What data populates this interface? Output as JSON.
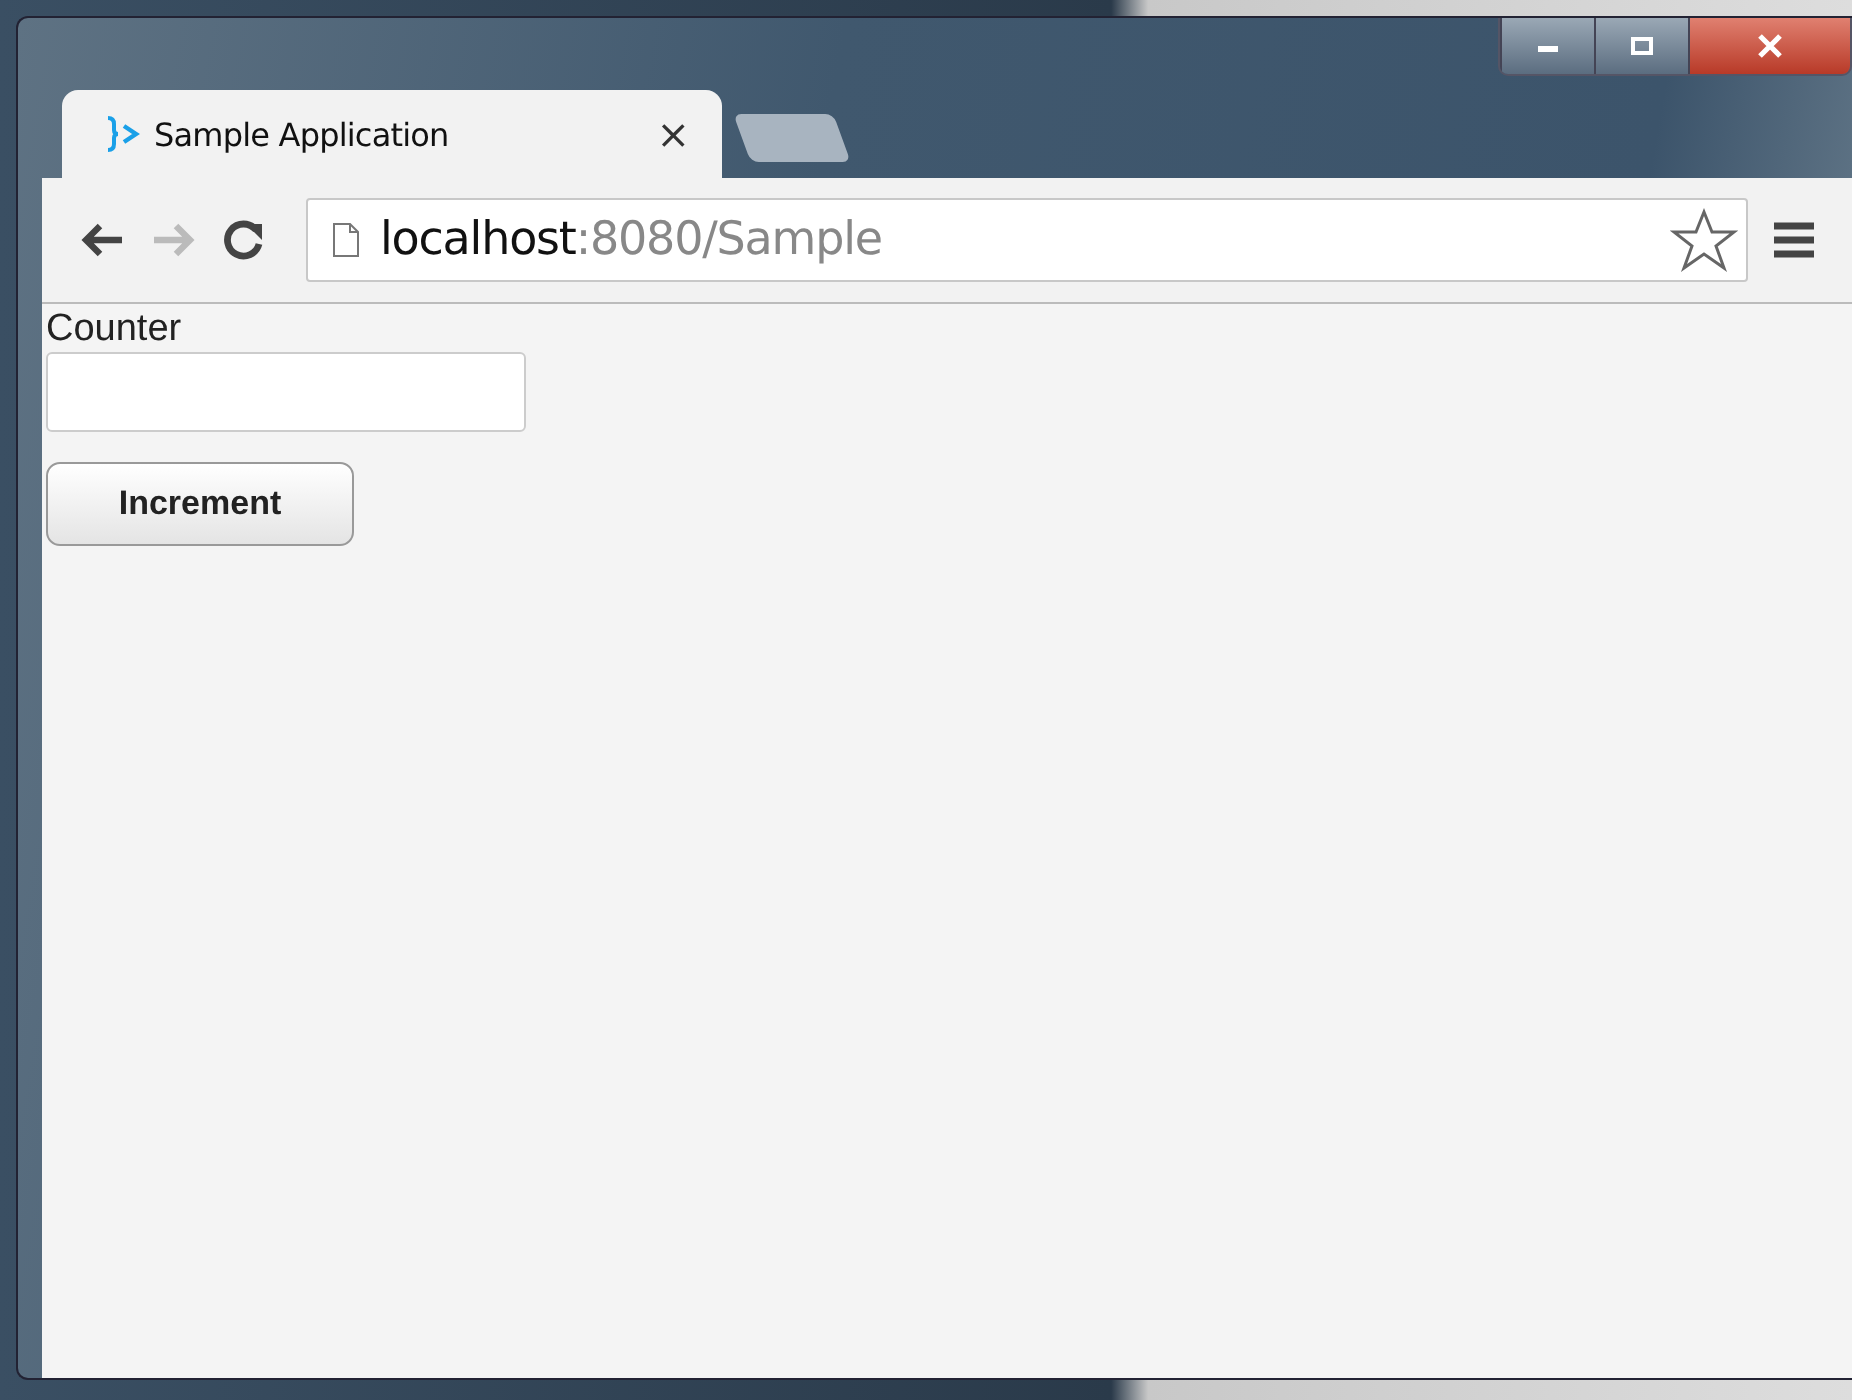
{
  "tabs": [
    {
      "title": "Sample Application",
      "close": "×",
      "selected": true
    }
  ],
  "address_bar": {
    "host": "localhost",
    "path": ":8080/Sample"
  },
  "page": {
    "label": "Counter",
    "button": "Increment"
  }
}
